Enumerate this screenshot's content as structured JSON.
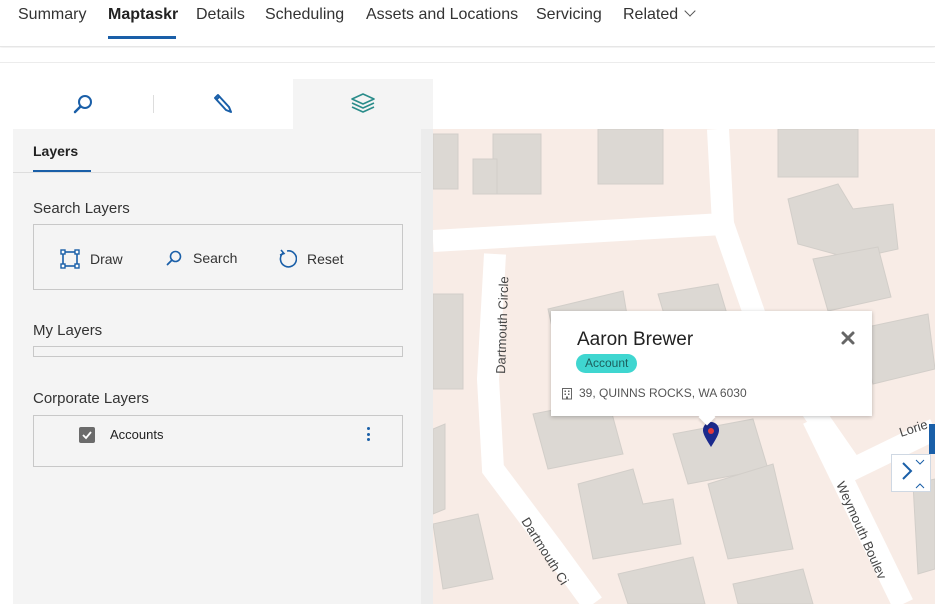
{
  "topnav": {
    "tabs": [
      {
        "label": "Summary"
      },
      {
        "label": "Maptaskr"
      },
      {
        "label": "Details"
      },
      {
        "label": "Scheduling"
      },
      {
        "label": "Assets and Locations"
      },
      {
        "label": "Servicing"
      },
      {
        "label": "Related"
      }
    ],
    "active_index": 1
  },
  "tooltabs": {
    "items": [
      {
        "icon": "search-icon"
      },
      {
        "icon": "pencil-icon"
      },
      {
        "icon": "layers-icon"
      }
    ],
    "active_index": 2
  },
  "panel": {
    "tab_label": "Layers",
    "search_layers": {
      "title": "Search Layers",
      "actions": [
        {
          "label": "Draw",
          "icon": "draw-select-icon"
        },
        {
          "label": "Search",
          "icon": "search-icon"
        },
        {
          "label": "Reset",
          "icon": "reset-icon"
        }
      ]
    },
    "my_layers": {
      "title": "My Layers"
    },
    "corporate_layers": {
      "title": "Corporate Layers",
      "items": [
        {
          "label": "Accounts",
          "checked": true
        }
      ]
    }
  },
  "map": {
    "streets": [
      "Dartmouth Circle",
      "Dartmouth Ci",
      "Weymouth Boulev",
      "Lorie"
    ],
    "popup": {
      "name": "Aaron Brewer",
      "badge": "Account",
      "address": "39, QUINNS ROCKS, WA 6030"
    },
    "colors": {
      "land": "#f8ece6",
      "road": "#ffffff",
      "building": "#dcd8d3",
      "accent": "#1a5fa8",
      "badge": "#3fd6d0",
      "pin": "#1b2a8c"
    }
  }
}
